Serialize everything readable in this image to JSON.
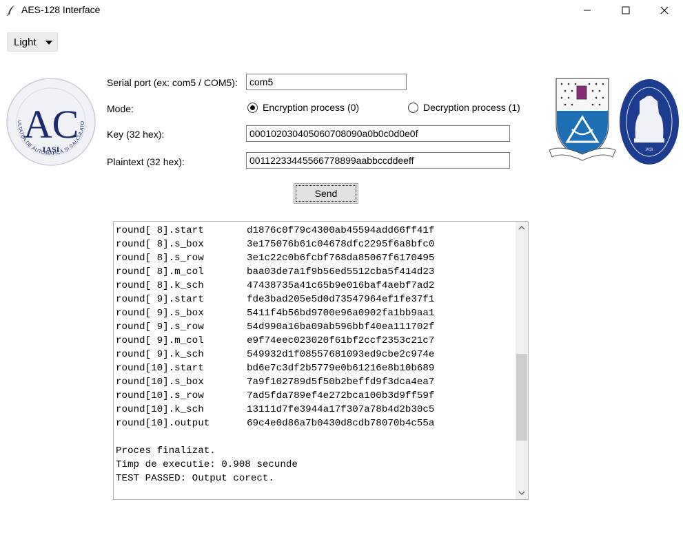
{
  "window": {
    "title": "AES-128 Interface",
    "icons": {
      "app": "feather-icon",
      "minimize": "minimize-icon",
      "maximize": "maximize-icon",
      "close": "close-icon"
    }
  },
  "theme_menu": {
    "value": "Light"
  },
  "logos": {
    "ac": {
      "letters": "AC",
      "city": "IAȘI",
      "ring_text": "FACULTATEA DE AUTOMATICĂ ȘI CALCULATOARE"
    },
    "tuiasi": {
      "city": "IAȘI"
    }
  },
  "form": {
    "port_label": "Serial port (ex: com5 / COM5):",
    "port_value": "com5",
    "mode_label": "Mode:",
    "mode_encrypt": "Encryption process (0)",
    "mode_decrypt": "Decryption process (1)",
    "mode_selected": "encrypt",
    "key_label": "Key (32 hex):",
    "key_value": "000102030405060708090a0b0c0d0e0f",
    "plaintext_label": "Plaintext (32 hex):",
    "plaintext_value": "00112233445566778899aabbccddeeff",
    "send_label": "Send"
  },
  "output": {
    "lines": [
      [
        "round[ 8].start",
        "d1876c0f79c4300ab45594add66ff41f"
      ],
      [
        "round[ 8].s_box",
        "3e175076b61c04678dfc2295f6a8bfc0"
      ],
      [
        "round[ 8].s_row",
        "3e1c22c0b6fcbf768da85067f6170495"
      ],
      [
        "round[ 8].m_col",
        "baa03de7a1f9b56ed5512cba5f414d23"
      ],
      [
        "round[ 8].k_sch",
        "47438735a41c65b9e016baf4aebf7ad2"
      ],
      [
        "round[ 9].start",
        "fde3bad205e5d0d73547964ef1fe37f1"
      ],
      [
        "round[ 9].s_box",
        "5411f4b56bd9700e96a0902fa1bb9aa1"
      ],
      [
        "round[ 9].s_row",
        "54d990a16ba09ab596bbf40ea111702f"
      ],
      [
        "round[ 9].m_col",
        "e9f74eec023020f61bf2ccf2353c21c7"
      ],
      [
        "round[ 9].k_sch",
        "549932d1f08557681093ed9cbe2c974e"
      ],
      [
        "round[10].start",
        "bd6e7c3df2b5779e0b61216e8b10b689"
      ],
      [
        "round[10].s_box",
        "7a9f102789d5f50b2beffd9f3dca4ea7"
      ],
      [
        "round[10].s_row",
        "7ad5fda789ef4e272bca100b3d9ff59f"
      ],
      [
        "round[10].k_sch",
        "13111d7fe3944a17f307a78b4d2b30c5"
      ],
      [
        "round[10].output",
        "69c4e0d86a7b0430d8cdb78070b4c55a"
      ],
      [
        "",
        ""
      ],
      [
        "Proces finalizat.",
        ""
      ],
      [
        "Timp de executie: 0.908 secunde",
        ""
      ],
      [
        "TEST PASSED: Output corect.",
        ""
      ]
    ]
  },
  "scroll": {
    "position_fraction": 0.72
  }
}
